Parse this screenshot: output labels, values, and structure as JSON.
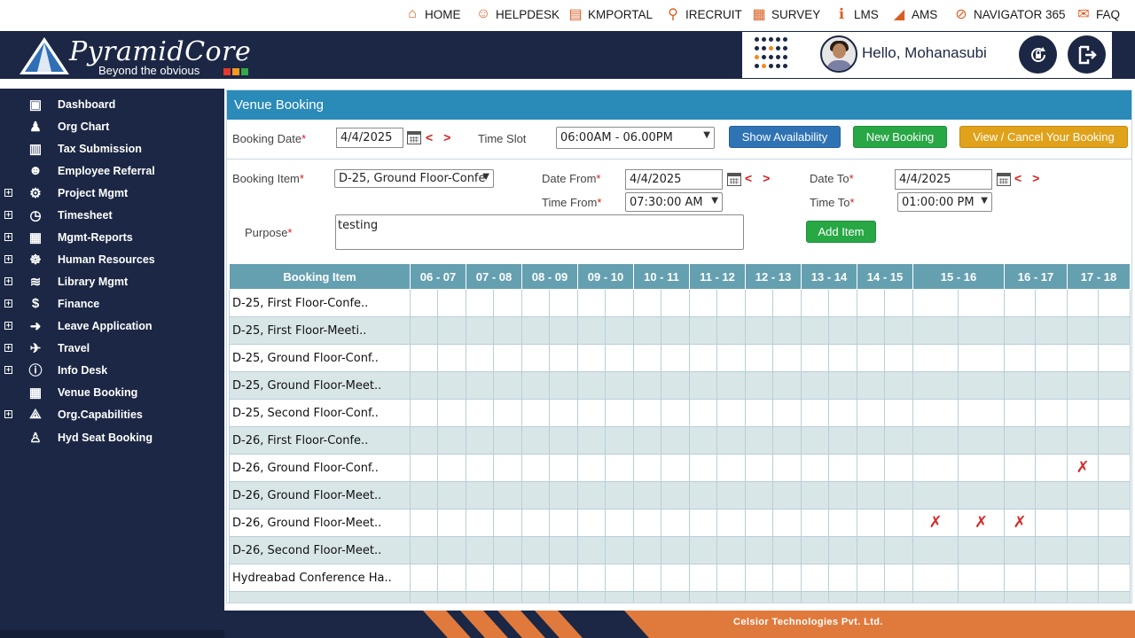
{
  "topnav": [
    {
      "label": "HOME",
      "icon": "home-icon",
      "glyph": "⌂"
    },
    {
      "label": "HELPDESK",
      "icon": "helpdesk-icon",
      "glyph": "☺"
    },
    {
      "label": "KMPORTAL",
      "icon": "kmportal-icon",
      "glyph": "▤"
    },
    {
      "label": "IRECRUIT",
      "icon": "irecruit-icon",
      "glyph": "⚲"
    },
    {
      "label": "SURVEY",
      "icon": "survey-icon",
      "glyph": "▦"
    },
    {
      "label": "LMS",
      "icon": "lms-icon",
      "glyph": "ℹ"
    },
    {
      "label": "AMS",
      "icon": "ams-icon",
      "glyph": "◢"
    },
    {
      "label": "NAVIGATOR 365",
      "icon": "navigator-icon",
      "glyph": "⊘"
    },
    {
      "label": "FAQ",
      "icon": "faq-icon",
      "glyph": "✉"
    }
  ],
  "header": {
    "brand": "PyramidCore",
    "tagline": "Beyond the obvious",
    "greeting": "Hello, Mohanasubi"
  },
  "sidebar": [
    {
      "label": "Dashboard",
      "icon": "dashboard-icon",
      "glyph": "▣",
      "expandable": false
    },
    {
      "label": "Org Chart",
      "icon": "org-chart-icon",
      "glyph": "♟",
      "expandable": false
    },
    {
      "label": "Tax Submission",
      "icon": "tax-submission-icon",
      "glyph": "▥",
      "expandable": false
    },
    {
      "label": "Employee Referral",
      "icon": "employee-referral-icon",
      "glyph": "☻",
      "expandable": false
    },
    {
      "label": "Project Mgmt",
      "icon": "project-mgmt-icon",
      "glyph": "⚙",
      "expandable": true
    },
    {
      "label": "Timesheet",
      "icon": "timesheet-icon",
      "glyph": "◷",
      "expandable": true
    },
    {
      "label": "Mgmt-Reports",
      "icon": "mgmt-reports-icon",
      "glyph": "▦",
      "expandable": true
    },
    {
      "label": "Human Resources",
      "icon": "human-resources-icon",
      "glyph": "☸",
      "expandable": true
    },
    {
      "label": "Library Mgmt",
      "icon": "library-mgmt-icon",
      "glyph": "≋",
      "expandable": true
    },
    {
      "label": "Finance",
      "icon": "finance-icon",
      "glyph": "$",
      "expandable": true
    },
    {
      "label": "Leave Application",
      "icon": "leave-application-icon",
      "glyph": "➜",
      "expandable": true
    },
    {
      "label": "Travel",
      "icon": "travel-icon",
      "glyph": "✈",
      "expandable": true
    },
    {
      "label": "Info Desk",
      "icon": "info-desk-icon",
      "glyph": "ⓘ",
      "expandable": true
    },
    {
      "label": "Venue Booking",
      "icon": "venue-booking-icon",
      "glyph": "▦",
      "expandable": false
    },
    {
      "label": "Org.Capabilities",
      "icon": "org-capabilities-icon",
      "glyph": "⟁",
      "expandable": true
    },
    {
      "label": "Hyd Seat Booking",
      "icon": "seat-booking-icon",
      "glyph": "♙",
      "expandable": false
    }
  ],
  "panel": {
    "title": "Venue Booking",
    "booking_date_label": "Booking Date",
    "booking_date_value": "4/4/2025",
    "time_slot_label": "Time Slot",
    "time_slot_value": "06:00AM - 06.00PM",
    "show_availability": "Show Availability",
    "new_booking": "New Booking",
    "view_cancel": "View / Cancel Your Booking",
    "booking_item_label": "Booking Item",
    "booking_item_value": "D-25, Ground Floor-Confe",
    "date_from_label": "Date From",
    "date_from_value": "4/4/2025",
    "date_to_label": "Date To",
    "date_to_value": "4/4/2025",
    "time_from_label": "Time From",
    "time_from_value": "07:30:00 AM",
    "time_to_label": "Time To",
    "time_to_value": "01:00:00 PM",
    "purpose_label": "Purpose",
    "purpose_value": "testing",
    "add_item": "Add Item",
    "nav_arrows": "< >",
    "required_mark": "*"
  },
  "grid": {
    "header_item": "Booking Item",
    "slots": [
      "06 - 07",
      "07 - 08",
      "08 - 09",
      "09 - 10",
      "10 - 11",
      "11 - 12",
      "12 - 13",
      "13 - 14",
      "14 - 15",
      "15 - 16",
      "16 - 17",
      "17 - 18"
    ],
    "rows": [
      {
        "name": "D-25, First Floor-Confe..",
        "booked": []
      },
      {
        "name": "D-25, First Floor-Meeti..",
        "booked": []
      },
      {
        "name": "D-25, Ground Floor-Conf..",
        "booked": []
      },
      {
        "name": "D-25, Ground Floor-Meet..",
        "booked": []
      },
      {
        "name": "D-25, Second Floor-Conf..",
        "booked": []
      },
      {
        "name": "D-26, First Floor-Confe..",
        "booked": []
      },
      {
        "name": "D-26, Ground Floor-Conf..",
        "booked": [
          22
        ]
      },
      {
        "name": "D-26, Ground Floor-Meet..",
        "booked": []
      },
      {
        "name": "D-26, Ground Floor-Meet..",
        "booked": [
          18,
          19,
          20
        ]
      },
      {
        "name": "D-26, Second Floor-Meet..",
        "booked": []
      },
      {
        "name": "Hydreabad Conference Ha..",
        "booked": []
      },
      {
        "name": "",
        "booked": []
      }
    ],
    "booked_mark": "✗"
  },
  "footer": {
    "company": "Celsior Technologies Pvt. Ltd."
  },
  "colors": {
    "navy": "#1b2744",
    "title_bar": "#2a8ab8",
    "grid_header": "#65a0b1",
    "accent_orange": "#e07a3c"
  }
}
